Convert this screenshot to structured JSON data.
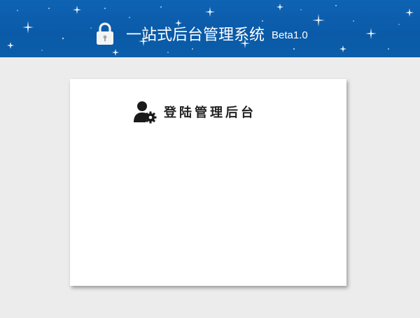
{
  "header": {
    "title": "一站式后台管理系统",
    "version": "Beta1.0",
    "bg_color": "#0a5fae",
    "icon": "lock-icon"
  },
  "login": {
    "title": "登陆管理后台",
    "icon": "user-gear-icon"
  }
}
